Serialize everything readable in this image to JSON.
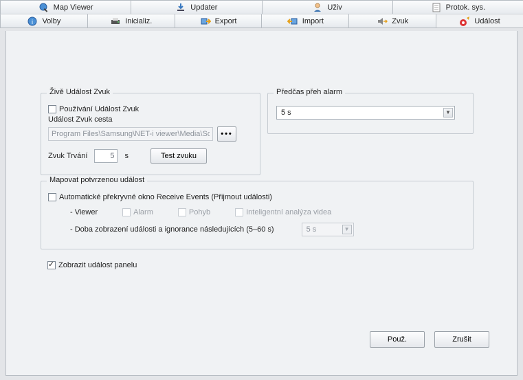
{
  "tabs": {
    "row1": [
      "Map Viewer",
      "Updater",
      "Uživ",
      "Protok. sys."
    ],
    "row2": [
      "Volby",
      "Inicializ.",
      "Export",
      "Import",
      "Zvuk",
      "Událost"
    ],
    "active": "Událost"
  },
  "live_group": {
    "legend": "Živě Událost Zvuk",
    "use_label": "Používání Událost Zvuk",
    "path_label": "Událost Zvuk cesta",
    "path_value": "Program Files\\Samsung\\NET-i viewer\\Media\\Sound",
    "browse_dots": "•••",
    "duration_label": "Zvuk Trvání",
    "duration_value": "5",
    "duration_unit": "s",
    "test_button": "Test zvuku"
  },
  "pre_group": {
    "legend": "Předčas přeh alarm",
    "value": "5 s"
  },
  "map_group": {
    "legend": "Mapovat potvrzenou událost",
    "auto_popup": "Automatické překryvné okno Receive Events (Přijmout události)",
    "viewer_label": "- Viewer",
    "alarm_label": "Alarm",
    "motion_label": "Pohyb",
    "iv_label": "Inteligentní analýza videa",
    "display_ignore_label": "- Doba zobrazení události a ignorance následujících (5–60 s)",
    "display_ignore_value": "5 s"
  },
  "show_panel": {
    "label": "Zobrazit událost panelu",
    "checked": true
  },
  "buttons": {
    "apply": "Použ.",
    "cancel": "Zrušit"
  }
}
